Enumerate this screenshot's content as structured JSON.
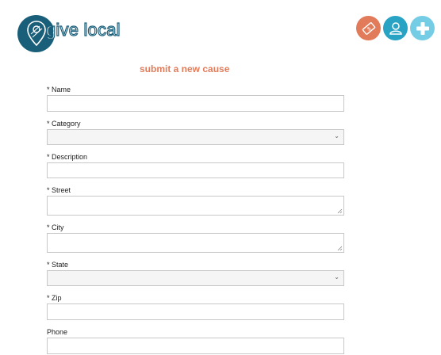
{
  "header": {
    "logo_text": "give local",
    "icons": [
      "donate-ticket-icon",
      "user-profile-icon",
      "add-cause-icon"
    ],
    "colors": {
      "brand": "#1a5f7a",
      "donate": "#e27b5a",
      "profile": "#29a3c4",
      "add": "#74cde4"
    }
  },
  "form": {
    "title": "submit a new cause",
    "fields": [
      {
        "label": "* Name",
        "type": "text",
        "value": ""
      },
      {
        "label": "* Category",
        "type": "select",
        "value": ""
      },
      {
        "label": "* Description",
        "type": "text",
        "value": ""
      },
      {
        "label": "* Street",
        "type": "textarea",
        "value": ""
      },
      {
        "label": "* City",
        "type": "textarea",
        "value": ""
      },
      {
        "label": "* State",
        "type": "select",
        "value": ""
      },
      {
        "label": "* Zip",
        "type": "text",
        "value": ""
      },
      {
        "label": "Phone",
        "type": "text",
        "value": ""
      }
    ]
  }
}
